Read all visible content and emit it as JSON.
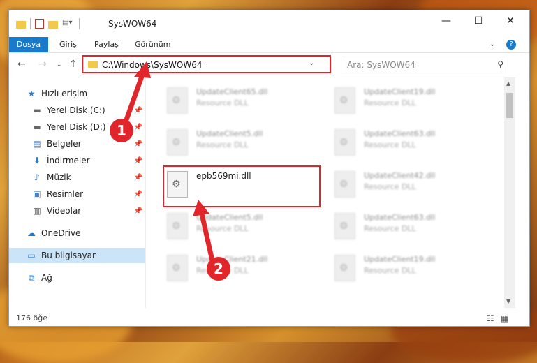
{
  "window": {
    "title": "SysWOW64"
  },
  "menu": {
    "items": [
      "Dosya",
      "Giriş",
      "Paylaş",
      "Görünüm"
    ]
  },
  "address": {
    "path": "C:\\Windows\\SysWOW64"
  },
  "search": {
    "placeholder": "Ara: SysWOW64"
  },
  "sidebar": {
    "items": [
      {
        "label": "Hızlı erişim",
        "icon": "star-icon",
        "pinned": false
      },
      {
        "label": "Yerel Disk (C:)",
        "icon": "drive-icon",
        "pinned": true
      },
      {
        "label": "Yerel Disk (D:)",
        "icon": "drive-icon",
        "pinned": true
      },
      {
        "label": "Belgeler",
        "icon": "documents-icon",
        "pinned": true
      },
      {
        "label": "İndirmeler",
        "icon": "download-icon",
        "pinned": true
      },
      {
        "label": "Müzik",
        "icon": "music-icon",
        "pinned": true
      },
      {
        "label": "Resimler",
        "icon": "pictures-icon",
        "pinned": true
      },
      {
        "label": "Videolar",
        "icon": "videos-icon",
        "pinned": true
      },
      {
        "label": "OneDrive",
        "icon": "cloud-icon",
        "pinned": false
      },
      {
        "label": "Bu bilgisayar",
        "icon": "computer-icon",
        "pinned": false,
        "selected": true
      },
      {
        "label": "Ağ",
        "icon": "network-icon",
        "pinned": false
      }
    ]
  },
  "files": {
    "left": [
      {
        "name": "UpdateClient65.dll",
        "type": "Resource DLL"
      },
      {
        "name": "UpdateClient5.dll",
        "type": "Resource DLL"
      },
      {
        "name": "epb569mi.dll",
        "type": ""
      },
      {
        "name": "UpdateClient5.dll",
        "type": "Resource DLL"
      },
      {
        "name": "UpdateClient21.dll",
        "type": "Resource DLL"
      }
    ],
    "right": [
      {
        "name": "UpdateClient19.dll",
        "type": "Resource DLL"
      },
      {
        "name": "UpdateClient63.dll",
        "type": "Resource DLL"
      },
      {
        "name": "UpdateClient42.dll",
        "type": "Resource DLL"
      },
      {
        "name": "UpdateClient63.dll",
        "type": "Resource DLL"
      },
      {
        "name": "UpdateClient19.dll",
        "type": "Resource DLL"
      }
    ]
  },
  "status": {
    "count": "176 öğe"
  },
  "callouts": [
    "1",
    "2"
  ],
  "colors": {
    "accent": "#1979ca",
    "highlight": "#e1262b",
    "selected": "#cce4f7"
  }
}
